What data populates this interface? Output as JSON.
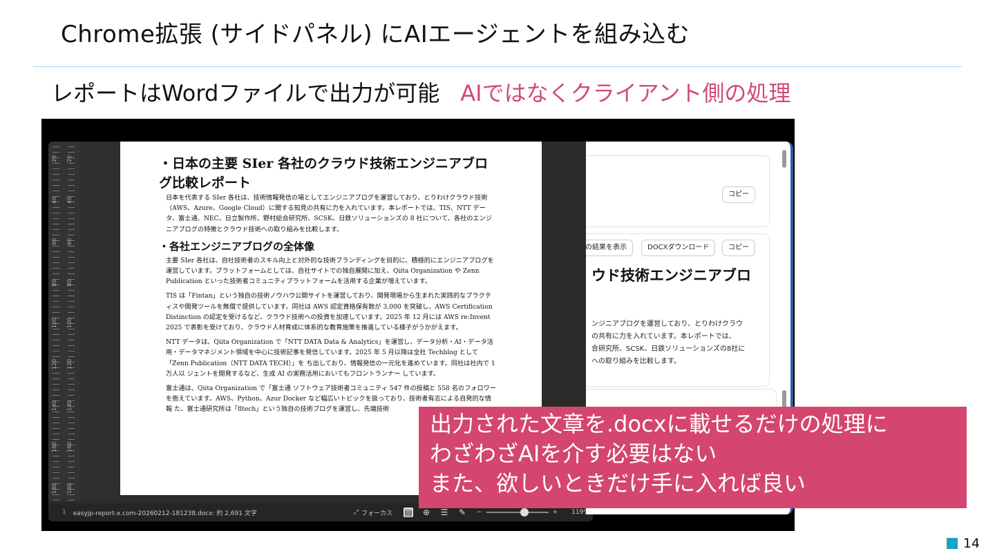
{
  "slide": {
    "title": "Chrome拡張 (サイドパネル) にAIエージェントを組み込む",
    "subtitle": "レポートはWordファイルで出力が可能",
    "subtitle_note": "AIではなくクライアント側の処理",
    "page_number": "14",
    "accent_color": "#1aa3c8",
    "note_color": "#d04a7c"
  },
  "word": {
    "ruler_labels": [
      "20",
      "20",
      "40",
      "40",
      "60",
      "60",
      "80",
      "80",
      "100",
      "100",
      "120",
      "120",
      "140",
      "140",
      "160",
      "160",
      "180",
      "160"
    ],
    "heading1": "日本の主要 SIer 各社のクラウド技術エンジニアブログ比較レポート",
    "para1": "日本を代表する SIer 各社は、技術情報発信の場としてエンジニアブログを運営しており、とりわけクラウド技術（AWS、Azure、Google Cloud）に関する知見の共有に力を入れています。本レポートでは、TIS、NTT データ、富士通、NEC、日立製作所、野村総合研究所、SCSK、日鉄ソリューションズの 8 社について、各社のエンジニアブログの特徴とクラウド技術への取り組みを比較します。",
    "heading2": "各社エンジニアブログの全体像",
    "para2": "主要 SIer 各社は、自社技術者のスキル向上と対外的な技術ブランディングを目的に、積極的にエンジニアブログを運営しています。プラットフォームとしては、自社サイトでの独自展開に加え、Qiita Organization や Zenn Publication といった技術者コミュニティプラットフォームを活用する企業が増えています。",
    "para3": "TIS は「Fintan」という独自の技術ノウハウ公開サイトを運営しており、開発現場から生まれた実践的なプラクティスや開発ツールを無償で提供しています。同社は AWS 認定資格保有数が 3,000 を突破し、AWS Certification Distinction の認定を受けるなど、クラウド技術への投資を加速しています。2025 年 12 月には AWS re:Invent 2025 で表彰を受けており、クラウド人材育成に体系的な教育施策を推進している様子がうかがえます。",
    "para4": "NTT データは、Qiita Organization で「NTT DATA Data & Analytics」を運営し、データ分析・AI・データ活用・データマネジメント領域を中心に技術記事を発信しています。2025 年 5 月以降は全社 Techblog として「Zenn Publication（NTT DATA TECH）」を ち出しており、情報発信の一元化を進めています。同社は社内で 1 万人以 ジェントを開発するなど、生成 AI の実務活用においてもフロントランナー しています。",
    "para5": "富士通は、Qiita Organization で「富士通 ソフトウェア技術者コミュニティ 547 件の投稿と 558 名のフォロワーを抱えています。AWS、Python、Azur Docker など幅広いトピックを扱っており、技術者有志による自発的な情報 た、富士通研究所は「fltech」という独自の技術ブログを運営し、先端技術",
    "status_page": "1",
    "status_file": "easyjp-report-x.com-20260212-181238.docx: 約 2,691 文字",
    "focus_label": "フォーカス",
    "zoom_minus": "−",
    "zoom_plus": "+",
    "zoom_level": "119%",
    "zoom_value": 0.62
  },
  "panel": {
    "copy_label_1": "コピー",
    "show_result_label": "の結果を表示",
    "docx_download_label": "DOCXダウンロード",
    "copy_label_2": "コピー",
    "heading": "ウド技術エンジニアブロ",
    "line1": "ンジニアブログを運営しており、とりわけクラウ",
    "line2": "の共有に力を入れています。本レポートでは、",
    "line3": "合研究所、SCSK、日鉄ソリューションズの8社に",
    "line4": "への取り組みを比較します。"
  },
  "callout": {
    "line1": "出力された文章を.docxに載せるだけの処理に",
    "line2": "わざわざAIを介す必要はない",
    "line3": "また、欲しいときだけ手に入れば良い",
    "color": "#d4466f"
  }
}
